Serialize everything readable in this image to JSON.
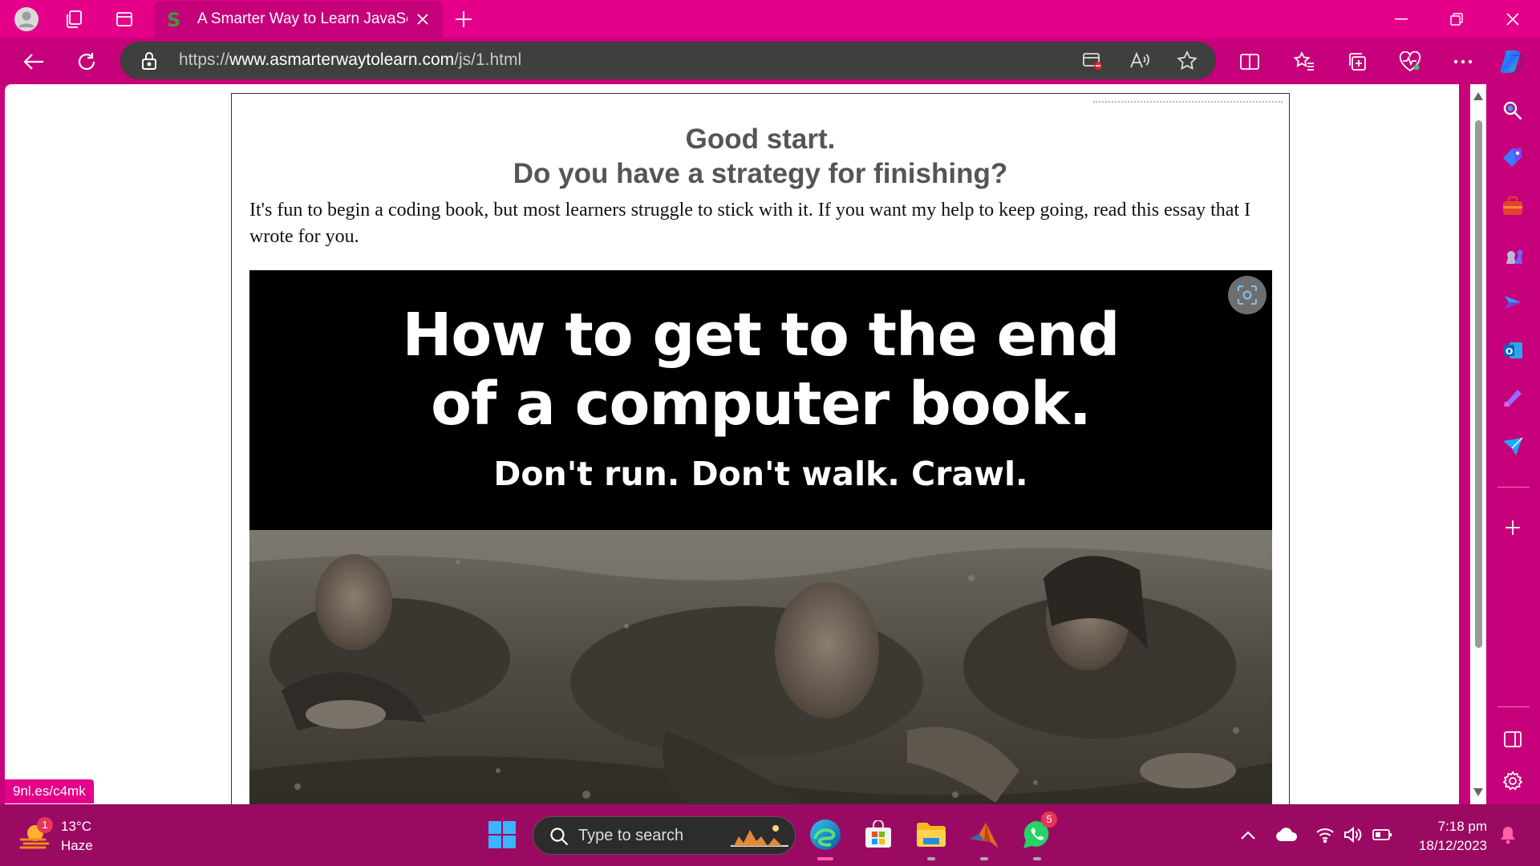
{
  "browser": {
    "tab": {
      "title": "A Smarter Way to Learn JavaScript",
      "favicon": "S"
    },
    "address": {
      "scheme": "https://",
      "host": "www.asmarterwaytolearn.com",
      "path": "/js/1.html"
    },
    "accent_color": "#e5008a"
  },
  "page": {
    "heading_line1": "Good start.",
    "heading_line2": "Do you have a strategy for finishing?",
    "intro": "It's fun to begin a coding book, but most learners struggle to stick with it. If you want my help to keep going, read this essay that I wrote for you.",
    "hero": {
      "title_line1": "How to get to the end",
      "title_line2": "of a computer book.",
      "subtitle": "Don't run. Don't walk. Crawl."
    }
  },
  "status_link": "9nl.es/c4mk",
  "taskbar": {
    "weather_temp": "13°C",
    "weather_condition": "Haze",
    "weather_badge": "1",
    "search_placeholder": "Type to search",
    "whatsapp_badge": "5",
    "time": "7:18 pm",
    "date": "18/12/2023"
  }
}
